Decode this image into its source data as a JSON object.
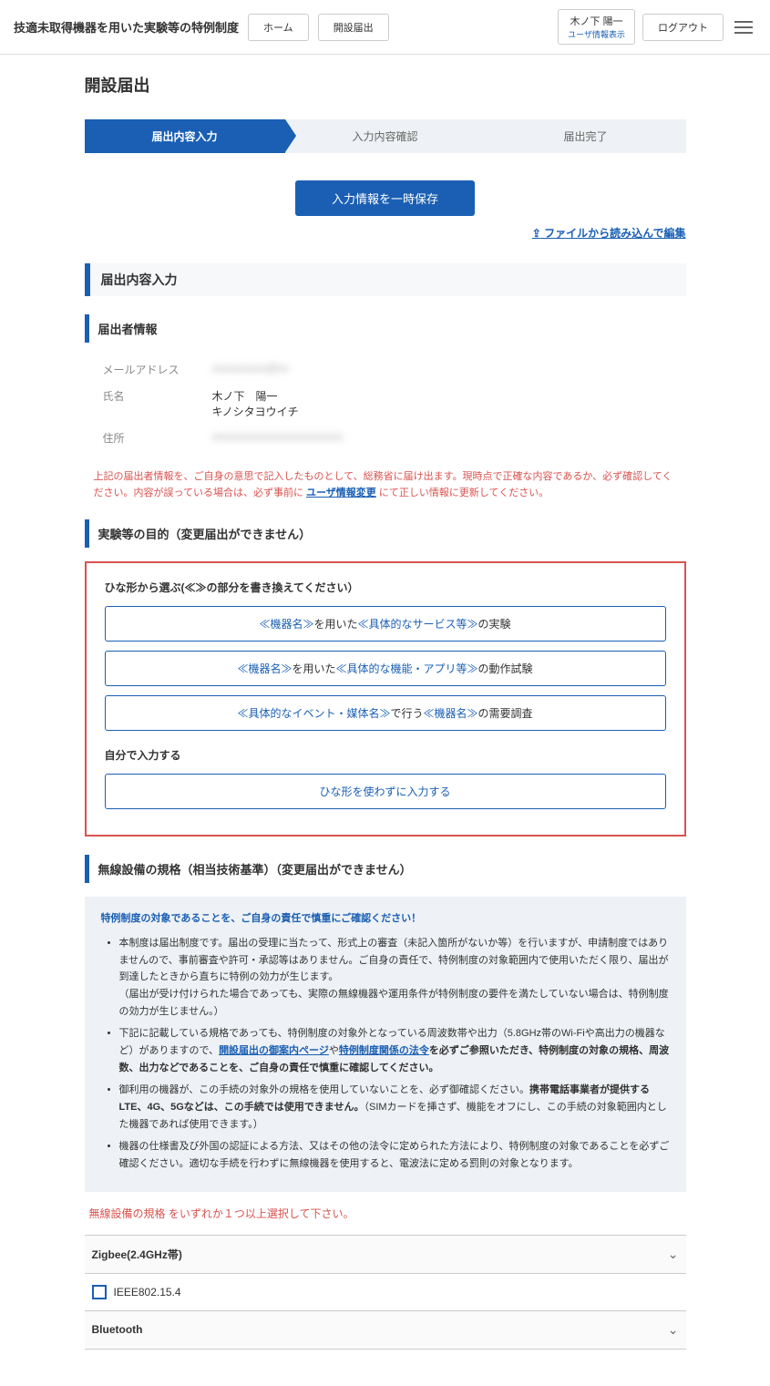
{
  "header": {
    "title": "技適未取得機器を用いた実験等の特例制度",
    "home_label": "ホーム",
    "notification_label": "開設届出",
    "user_name": "木ノ下 陽一",
    "user_sub": "ユーザ情報表示",
    "logout_label": "ログアウト"
  },
  "page": {
    "title": "開設届出",
    "progress": {
      "step1": "届出内容入力",
      "step2": "入力内容確認",
      "step3": "届出完了"
    },
    "save_button": "入力情報を一時保存",
    "file_link_icon": "⇪",
    "file_link": "ファイルから読み込んで編集"
  },
  "sections": {
    "input_title": "届出内容入力",
    "applicant_title": "届出者情報",
    "applicant": {
      "email_label": "メールアドレス",
      "email_value": "xxxxxxxxxx@xx",
      "name_label": "氏名",
      "name_value1": "木ノ下　陽一",
      "name_value2": "キノシタヨウイチ",
      "address_label": "住所",
      "address_value": "xxxxxxxxxxxxxxxxxxxxxxxx"
    },
    "applicant_notice_1": "上記の届出者情報を、ご自身の意思で記入したものとして、総務省に届け出ます。現時点で正確な内容であるか、必ず確認してください。内容が誤っている場合は、必ず事前に",
    "applicant_notice_link": "ユーザ情報変更",
    "applicant_notice_2": "にて正しい情報に更新してください。",
    "purpose_title": "実験等の目的（変更届出ができません）",
    "purpose": {
      "template_heading": "ひな形から選ぶ(≪≫の部分を書き換えてください）",
      "opt1_pre": "≪機器名≫",
      "opt1_mid": "を用いた",
      "opt1_em": "≪具体的なサービス等≫",
      "opt1_post": "の実験",
      "opt2_pre": "≪機器名≫",
      "opt2_mid": "を用いた",
      "opt2_em": "≪具体的な機能・アプリ等≫",
      "opt2_post": "の動作試験",
      "opt3_pre": "≪具体的なイベント・媒体名≫",
      "opt3_mid": "で行う",
      "opt3_em": "≪機器名≫",
      "opt3_post": "の需要調査",
      "manual_heading": "自分で入力する",
      "manual_btn": "ひな形を使わずに入力する"
    },
    "spec_title": "無線設備の規格（相当技術基準）（変更届出ができません）",
    "spec_notice": {
      "title": "特例制度の対象であることを、ご自身の責任で慎重にご確認ください！",
      "li1": "本制度は届出制度です。届出の受理に当たって、形式上の審査（未記入箇所がないか等）を行いますが、申請制度ではありませんので、事前審査や許可・承認等はありません。ご自身の責任で、特例制度の対象範囲内で使用いただく限り、届出が到達したときから直ちに特例の効力が生じます。",
      "li1_sub": "（届出が受け付けられた場合であっても、実際の無線機器や運用条件が特例制度の要件を満たしていない場合は、特例制度の効力が生じません。）",
      "li2_pre": "下記に記載している規格であっても、特例制度の対象外となっている周波数帯や出力（5.8GHz帯のWi-Fiや高出力の機器など）がありますので、",
      "li2_link1": "開設届出の御案内ページ",
      "li2_mid": "や",
      "li2_link2": "特例制度関係の法令",
      "li2_post": "を必ずご参照いただき、特例制度の対象の規格、周波数、出力などであることを、ご自身の責任で慎重に確認してください。",
      "li3_pre": "御利用の機器が、この手続の対象外の規格を使用していないことを、必ず御確認ください。",
      "li3_bold": "携帯電話事業者が提供するLTE、4G、5Gなどは、この手続では使用できません。",
      "li3_post": "（SIMカードを挿さず、機能をオフにし、この手続の対象範囲内とした機器であれば使用できます。）",
      "li4": "機器の仕様書及び外国の認証による方法、又はその他の法令に定められた方法により、特例制度の対象であることを必ずご確認ください。適切な手続を行わずに無線機器を使用すると、電波法に定める罰則の対象となります。"
    },
    "spec_error": "無線設備の規格 をいずれか１つ以上選択して下さい。",
    "accordion": {
      "zigbee_title": "Zigbee(2.4GHz帯)",
      "zigbee_item": "IEEE802.15.4",
      "bluetooth_title": "Bluetooth"
    }
  }
}
